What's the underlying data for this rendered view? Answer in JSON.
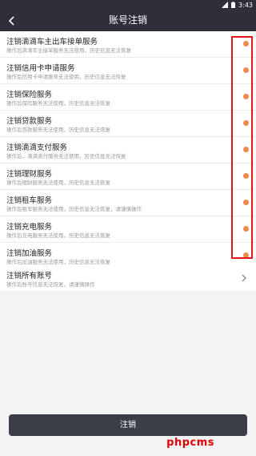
{
  "status": {
    "time": "3:43"
  },
  "header": {
    "title": "账号注销"
  },
  "services": [
    {
      "title": "注销滴滴车主出车接单服务",
      "subtitle": "操作后滴滴车主接单服务无法使用，历史信息无法恢复"
    },
    {
      "title": "注销信用卡申请服务",
      "subtitle": "操作后信用卡申请服务无法使用，历史信息无法恢复"
    },
    {
      "title": "注销保险服务",
      "subtitle": "操作后保险服务无法使用，历史信息无法恢复"
    },
    {
      "title": "注销贷款服务",
      "subtitle": "操作后贷款服务无法使用，历史信息无法恢复"
    },
    {
      "title": "注销滴滴支付服务",
      "subtitle": "操作后，滴滴支付服务无法使用，历史信息无法恢复"
    },
    {
      "title": "注销理财服务",
      "subtitle": "操作后理财服务无法使用，历史信息无法恢复"
    },
    {
      "title": "注销租车服务",
      "subtitle": "操作后租车服务无法使用，历史信息无法恢复，请谨慎操作"
    },
    {
      "title": "注销充电服务",
      "subtitle": "操作后充电服务无法使用，历史信息无法恢复"
    },
    {
      "title": "注销加油服务",
      "subtitle": "操作后加油服务无法使用，历史信息无法恢复"
    }
  ],
  "all_account": {
    "title": "注销所有账号",
    "subtitle": "操作后账号信息无法恢复，请谨慎操作"
  },
  "cancel_button": {
    "label": "注销"
  },
  "watermark": "phpcms",
  "colors": {
    "nav": "#2e2f3a",
    "dot": "#f08a4b",
    "highlight": "#e8141a",
    "button": "#3b3d48"
  }
}
